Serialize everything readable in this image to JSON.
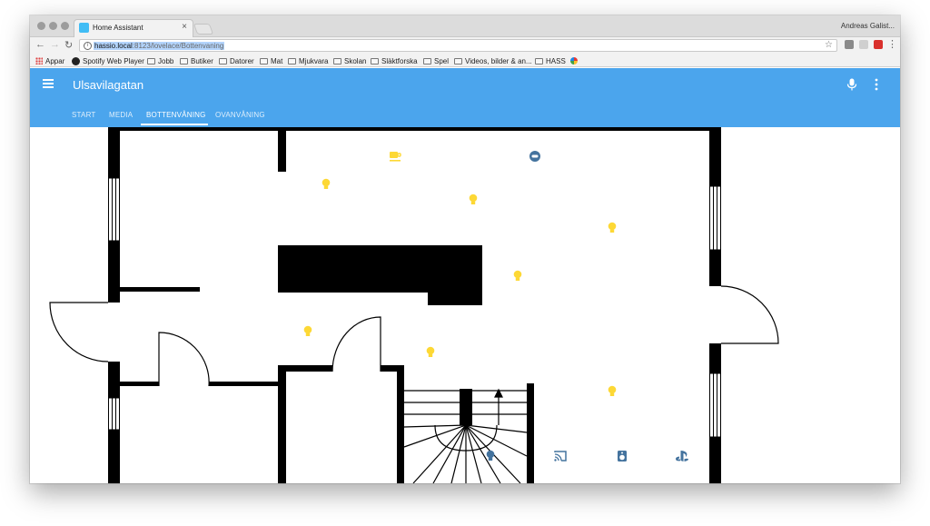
{
  "browser": {
    "tab_title": "Home Assistant",
    "tab_close": "×",
    "profile_name": "Andreas Galist...",
    "url_host": "hassio.local",
    "url_rest": ":8123/lovelace/Bottenvaning",
    "bookmarks": [
      "Appar",
      "Spotify Web Player",
      "Jobb",
      "Butiker",
      "Datorer",
      "Mat",
      "Mjukvara",
      "Skolan",
      "Släktforska",
      "Spel",
      "Videos, bilder & an...",
      "HASS"
    ]
  },
  "app": {
    "title": "Ulsavilagatan",
    "tabs": [
      "START",
      "MEDIA",
      "BOTTENVÅNING",
      "OVANVÅNING"
    ],
    "active_tab": "BOTTENVÅNING",
    "header_color": "#4ba5ed"
  },
  "floorplan": {
    "entities": [
      {
        "icon": "coffee-icon",
        "state": "on"
      },
      {
        "icon": "robot-vacuum-icon",
        "state": "off"
      },
      {
        "icon": "lightbulb-icon",
        "state": "on"
      },
      {
        "icon": "lightbulb-icon",
        "state": "on"
      },
      {
        "icon": "lightbulb-icon",
        "state": "on"
      },
      {
        "icon": "lightbulb-icon",
        "state": "on"
      },
      {
        "icon": "lightbulb-icon",
        "state": "on"
      },
      {
        "icon": "lightbulb-icon",
        "state": "on"
      },
      {
        "icon": "lightbulb-icon",
        "state": "on"
      },
      {
        "icon": "lightbulb-icon",
        "state": "off"
      },
      {
        "icon": "cast-icon",
        "state": "off"
      },
      {
        "icon": "speaker-icon",
        "state": "off"
      },
      {
        "icon": "playstation-icon",
        "state": "off"
      }
    ],
    "colors": {
      "on": "#fdd835",
      "off": "#44739e",
      "wall": "#000000"
    }
  }
}
